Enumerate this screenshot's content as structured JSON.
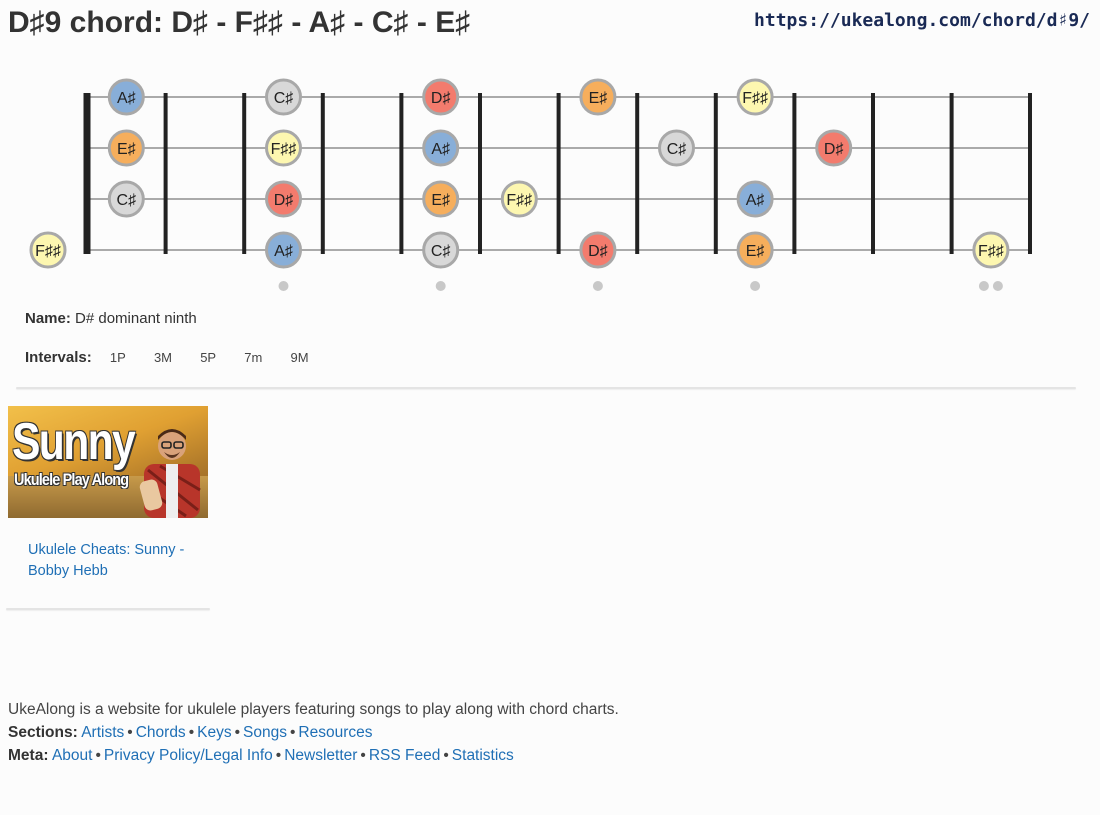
{
  "page": {
    "title": "D♯9 chord: D♯ - F♯♯ - A♯ - C♯ - E♯",
    "url": "https://ukealong.com/chord/d♯9/"
  },
  "fretboard": {
    "strings": [
      "A",
      "E",
      "C",
      "G"
    ],
    "fret_count": 12,
    "inlay_frets": [
      3,
      5,
      7,
      9,
      12
    ],
    "note_colors": {
      "A♯": "#88aed8",
      "E♯": "#f6ae5c",
      "C♯": "#d8d8d8",
      "F♯♯": "#fdf7b0",
      "D♯": "#f37b6d"
    },
    "markers": [
      {
        "note": "A♯",
        "string": 0,
        "fret": 1
      },
      {
        "note": "C♯",
        "string": 0,
        "fret": 3
      },
      {
        "note": "D♯",
        "string": 0,
        "fret": 5
      },
      {
        "note": "E♯",
        "string": 0,
        "fret": 7
      },
      {
        "note": "F♯♯",
        "string": 0,
        "fret": 9
      },
      {
        "note": "E♯",
        "string": 1,
        "fret": 1
      },
      {
        "note": "F♯♯",
        "string": 1,
        "fret": 3
      },
      {
        "note": "A♯",
        "string": 1,
        "fret": 5
      },
      {
        "note": "C♯",
        "string": 1,
        "fret": 8
      },
      {
        "note": "D♯",
        "string": 1,
        "fret": 10
      },
      {
        "note": "C♯",
        "string": 2,
        "fret": 1
      },
      {
        "note": "D♯",
        "string": 2,
        "fret": 3
      },
      {
        "note": "E♯",
        "string": 2,
        "fret": 5
      },
      {
        "note": "F♯♯",
        "string": 2,
        "fret": 6
      },
      {
        "note": "A♯",
        "string": 2,
        "fret": 9
      },
      {
        "note": "F♯♯",
        "string": 3,
        "fret": 0
      },
      {
        "note": "A♯",
        "string": 3,
        "fret": 3
      },
      {
        "note": "C♯",
        "string": 3,
        "fret": 5
      },
      {
        "note": "D♯",
        "string": 3,
        "fret": 7
      },
      {
        "note": "E♯",
        "string": 3,
        "fret": 9
      },
      {
        "note": "F♯♯",
        "string": 3,
        "fret": 12
      }
    ]
  },
  "info": {
    "name_label": "Name:",
    "name_value": "D# dominant ninth",
    "intervals_label": "Intervals:",
    "intervals": [
      "1P",
      "3M",
      "5P",
      "7m",
      "9M"
    ]
  },
  "related": {
    "thumb_title": "Sunny",
    "thumb_subtitle": "Ukulele Play Along",
    "link_text": "Ukulele Cheats: Sunny - Bobby Hebb"
  },
  "footer": {
    "description": "UkeAlong is a website for ukulele players featuring songs to play along with chord charts.",
    "sections_label": "Sections:",
    "sections": [
      "Artists",
      "Chords",
      "Keys",
      "Songs",
      "Resources"
    ],
    "meta_label": "Meta:",
    "meta": [
      "About",
      "Privacy Policy/Legal Info",
      "Newsletter",
      "RSS Feed",
      "Statistics"
    ],
    "separator": "•"
  }
}
